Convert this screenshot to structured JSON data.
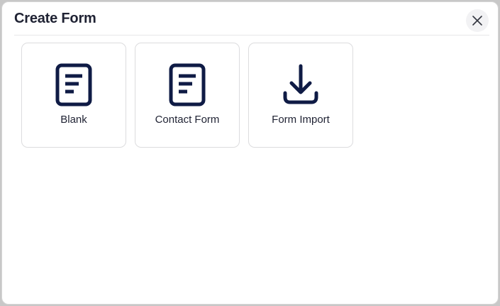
{
  "dialog": {
    "title": "Create Form",
    "close_icon": "close-icon"
  },
  "options": [
    {
      "label": "Blank",
      "icon": "document-icon"
    },
    {
      "label": "Contact Form",
      "icon": "document-icon"
    },
    {
      "label": "Form Import",
      "icon": "download-icon"
    }
  ],
  "colors": {
    "icon": "#0f1b45",
    "text": "#1f2233",
    "card_border": "#dcdcde",
    "background": "#ffffff"
  }
}
